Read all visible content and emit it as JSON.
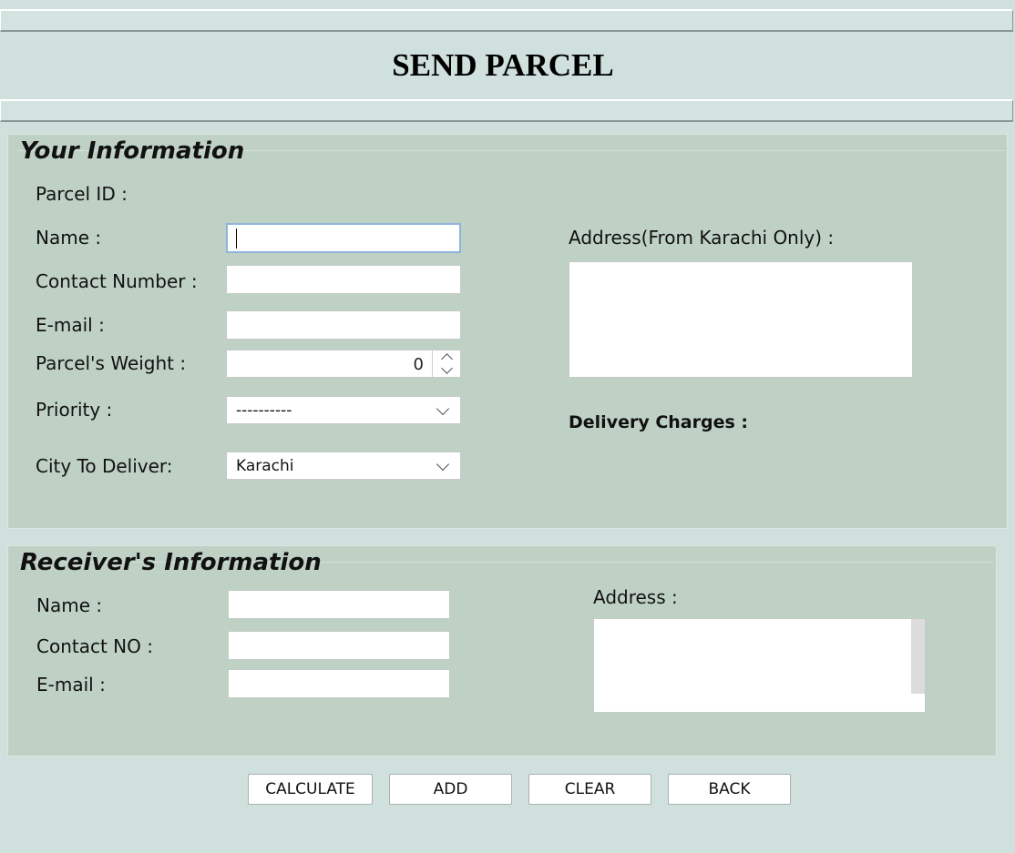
{
  "header": {
    "title": "SEND PARCEL"
  },
  "sender": {
    "title": "Your Information",
    "parcel_id_label": "Parcel ID :",
    "name_label": "Name :",
    "contact_label": "Contact Number :",
    "email_label": "E-mail :",
    "weight_label": "Parcel's Weight :",
    "weight_value": "0",
    "priority_label": "Priority :",
    "priority_value": "----------",
    "city_label": "City To Deliver:",
    "city_value": "Karachi",
    "address_label": "Address(From Karachi Only) :",
    "charges_label": "Delivery Charges :"
  },
  "receiver": {
    "title": "Receiver's Information",
    "name_label": "Name :",
    "contact_label": "Contact NO :",
    "email_label": "E-mail :",
    "address_label": "Address :"
  },
  "buttons": {
    "calculate": "CALCULATE",
    "add": "ADD",
    "clear": "CLEAR",
    "back": "BACK"
  },
  "colors": {
    "background": "#cfe0dd",
    "panel": "#bfd1c5",
    "focus_border": "#8fb4dc"
  }
}
